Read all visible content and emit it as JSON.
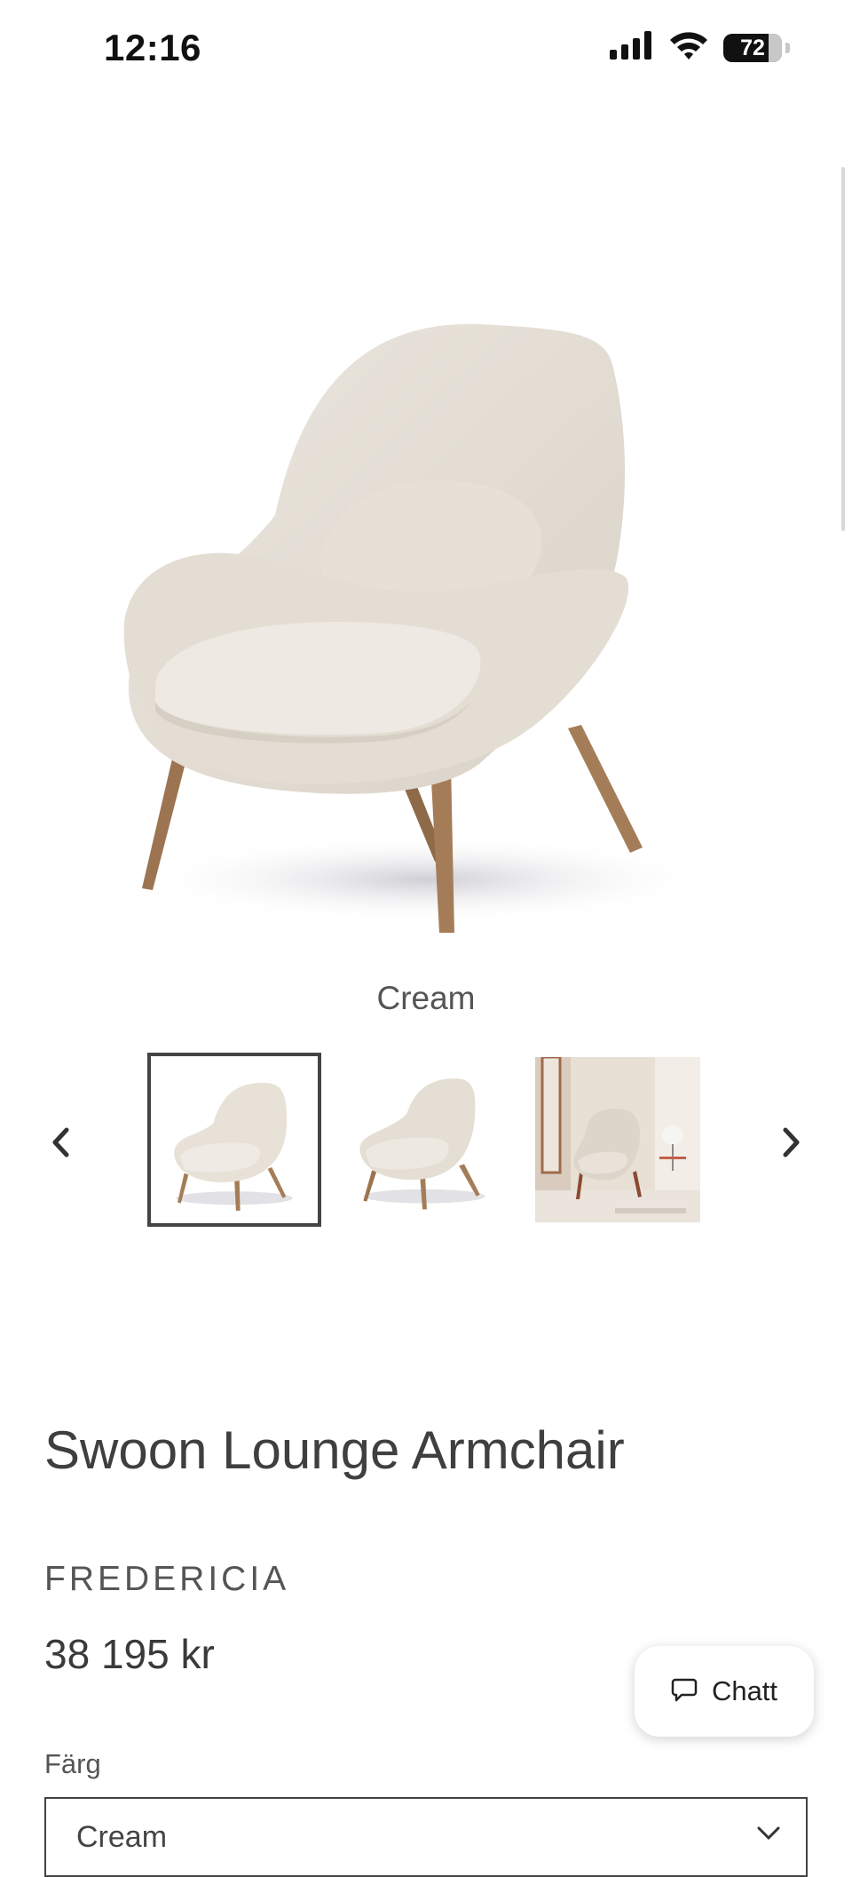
{
  "status_bar": {
    "time": "12:16",
    "battery_percent": "72"
  },
  "product": {
    "image_caption": "Cream",
    "title": "Swoon Lounge Armchair",
    "brand": "FREDERICIA",
    "price": "38 195 kr"
  },
  "gallery": {
    "selected_index": 0,
    "thumbnail_count": 3
  },
  "chat": {
    "label": "Chatt"
  },
  "color_select": {
    "label": "Färg",
    "value": "Cream"
  },
  "colors": {
    "upholstery": "#e9e3da",
    "wood": "#a47d58",
    "text": "#3a3a3a"
  }
}
